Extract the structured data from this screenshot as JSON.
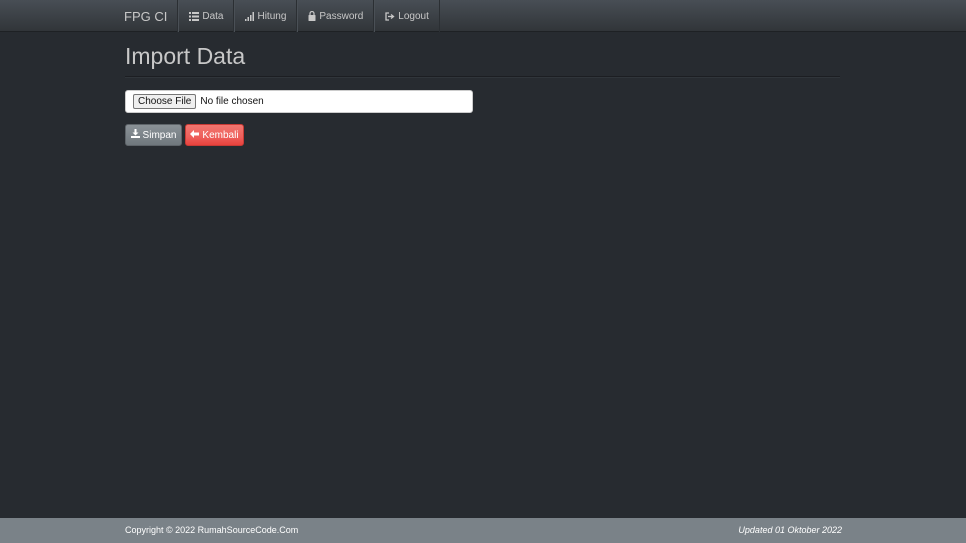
{
  "navbar": {
    "brand": "FPG CI",
    "items": [
      {
        "label": "Data",
        "icon": "list-icon"
      },
      {
        "label": "Hitung",
        "icon": "signal-icon"
      },
      {
        "label": "Password",
        "icon": "lock-icon"
      },
      {
        "label": "Logout",
        "icon": "logout-icon"
      }
    ]
  },
  "page": {
    "title": "Import Data"
  },
  "file_input": {
    "button_label": "Choose File",
    "status": "No file chosen"
  },
  "actions": {
    "save_label": "Simpan",
    "back_label": "Kembali"
  },
  "footer": {
    "copyright": "Copyright © 2022 RumahSourceCode.Com",
    "updated": "Updated 01 Oktober 2022"
  },
  "colors": {
    "background": "#272b30",
    "navbar": "#3a3f44",
    "save": "#7a8288",
    "back": "#ee5f5b",
    "footer": "#7a8288"
  }
}
